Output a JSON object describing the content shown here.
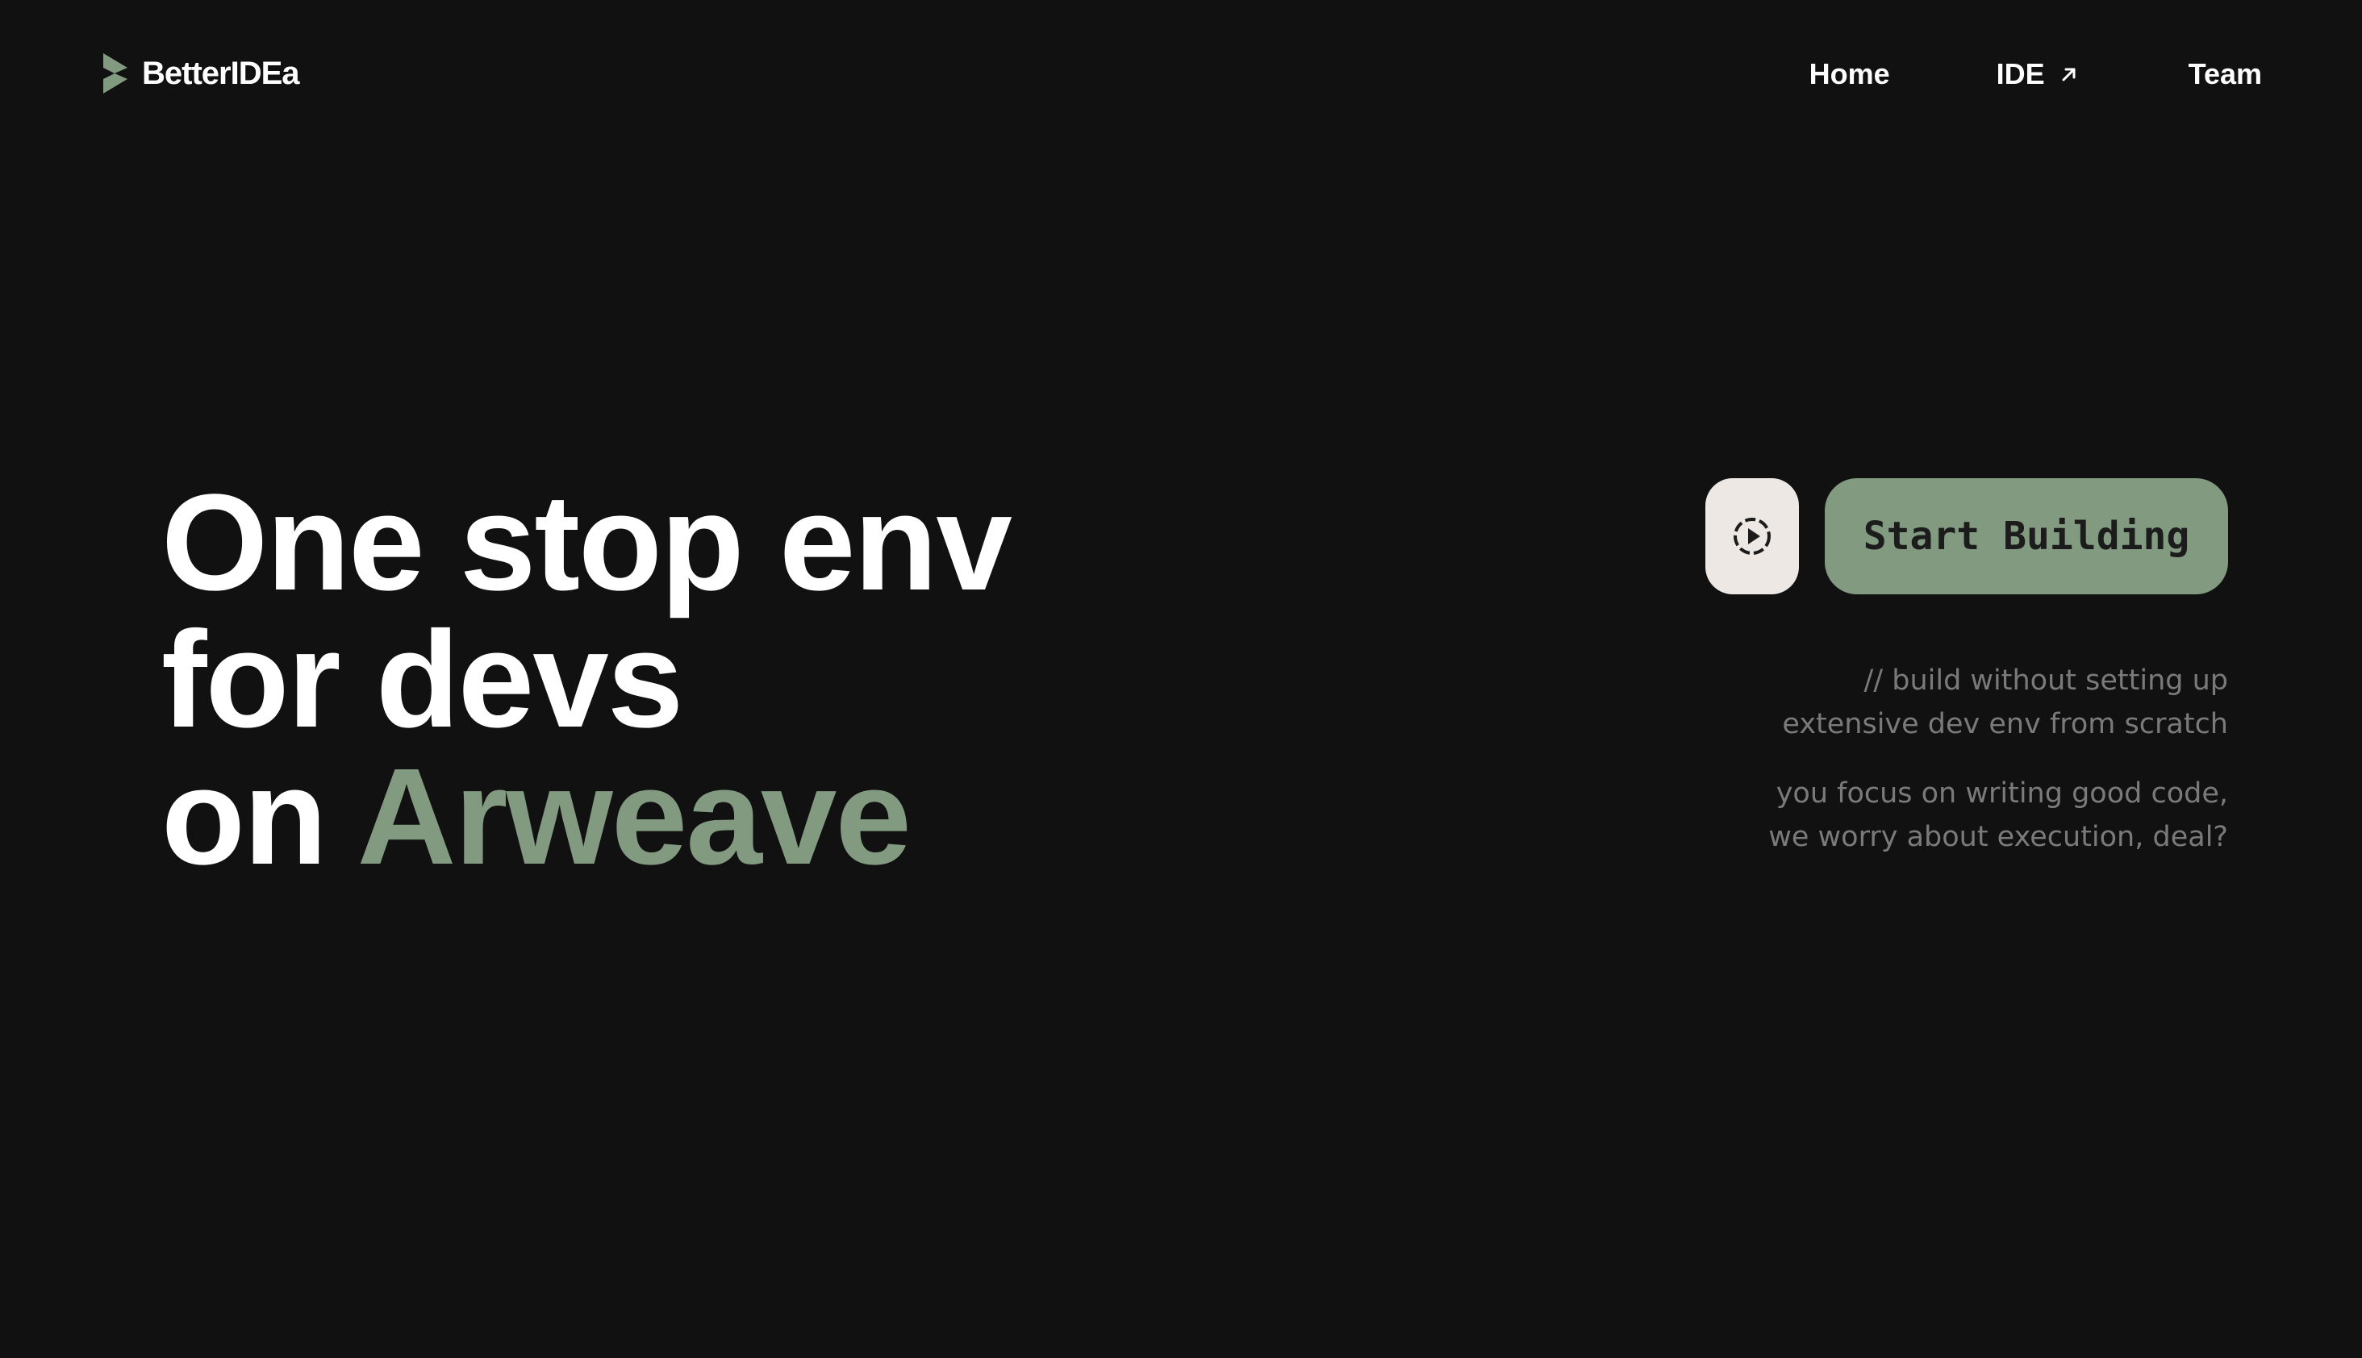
{
  "header": {
    "logo_text": "BetterIDEa",
    "nav": {
      "home": "Home",
      "ide": "IDE",
      "team": "Team"
    }
  },
  "hero": {
    "line1": "One stop env",
    "line2": "for devs",
    "line3_prefix": "on ",
    "line3_accent": "Arweave"
  },
  "cta": {
    "demo_icon": "play-circle-icon",
    "start_label": "Start Building"
  },
  "tagline": {
    "p1_line1": "// build without setting up",
    "p1_line2": "extensive dev env from scratch",
    "p2_line1": "you focus on writing good code,",
    "p2_line2": "we worry about execution, deal?"
  },
  "colors": {
    "background": "#111111",
    "accent": "#829a80",
    "demo_button_bg": "#ede8e4",
    "muted_text": "#7a7a7a"
  }
}
